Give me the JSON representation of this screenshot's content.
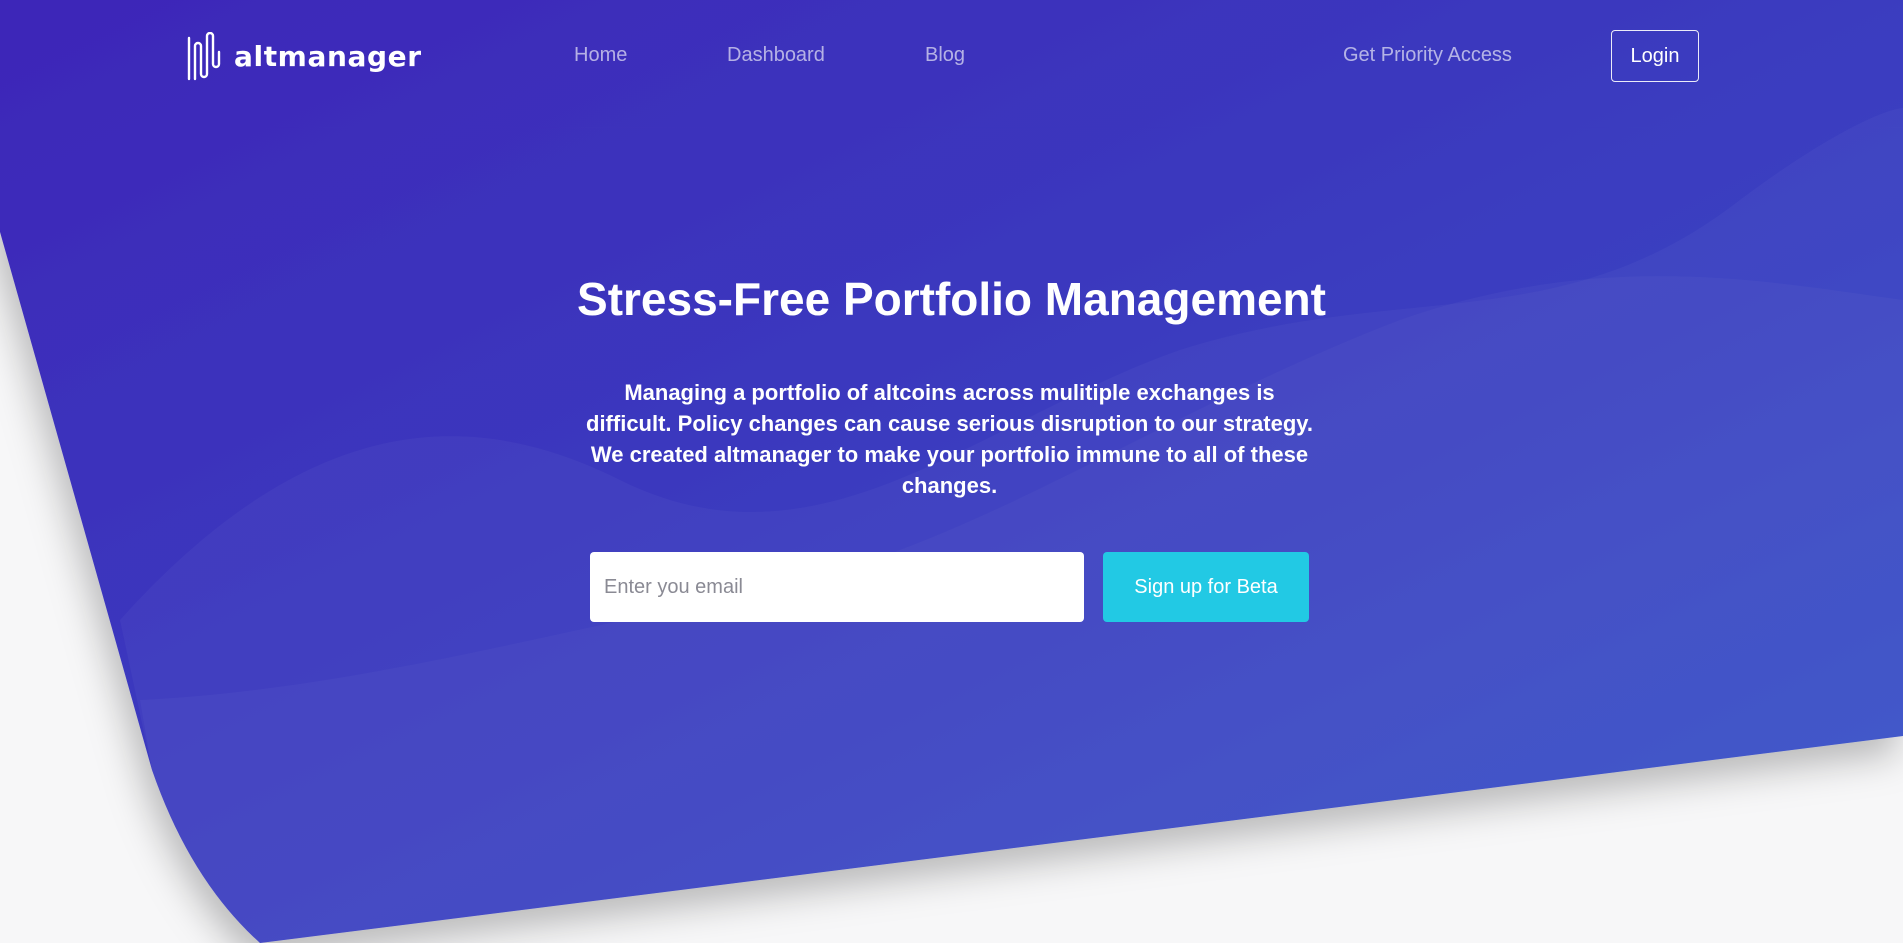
{
  "brand": {
    "name": "altmanager",
    "logo_icon": "waveform-logo-icon"
  },
  "nav": {
    "links": [
      {
        "label": "Home"
      },
      {
        "label": "Dashboard"
      },
      {
        "label": "Blog"
      },
      {
        "label": "Get Priority Access"
      }
    ],
    "login_label": "Login"
  },
  "hero": {
    "title": "Stress-Free Portfolio Management",
    "description": "Managing a portfolio of altcoins across mulitiple exchanges is difficult. Policy changes can cause serious disruption to our strategy. We created altmanager to make your portfolio immune to all of these changes.",
    "email_placeholder": "Enter you email",
    "email_value": "",
    "signup_label": "Sign up for Beta"
  },
  "colors": {
    "gradient_start": "#3d26b8",
    "gradient_end": "#3352c8",
    "accent": "#22c9e4",
    "page_background": "#f7f7f8"
  }
}
